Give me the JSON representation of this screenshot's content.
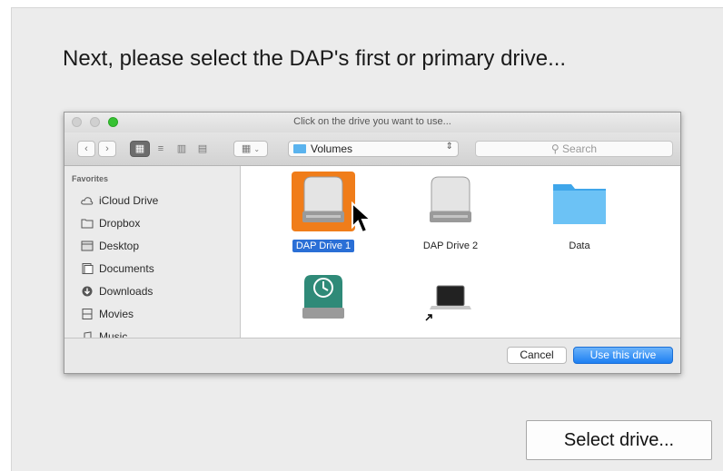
{
  "instruction": "Next, please select the DAP's first or primary drive...",
  "dialog": {
    "title": "Click on the drive you want to use...",
    "location": "Volumes",
    "search_placeholder": "Search",
    "sidebar": {
      "heading": "Favorites",
      "items": [
        {
          "label": "iCloud Drive",
          "icon": "cloud-icon"
        },
        {
          "label": "Dropbox",
          "icon": "folder-icon"
        },
        {
          "label": "Desktop",
          "icon": "desktop-icon"
        },
        {
          "label": "Documents",
          "icon": "documents-icon"
        },
        {
          "label": "Downloads",
          "icon": "downloads-icon"
        },
        {
          "label": "Movies",
          "icon": "movies-icon"
        },
        {
          "label": "Music",
          "icon": "music-icon"
        }
      ]
    },
    "files": [
      {
        "label": "DAP Drive 1",
        "icon": "hard-drive-icon",
        "selected": true
      },
      {
        "label": "DAP Drive 2",
        "icon": "hard-drive-icon",
        "selected": false
      },
      {
        "label": "Data",
        "icon": "folder-icon",
        "selected": false
      },
      {
        "label": "",
        "icon": "time-machine-drive-icon",
        "selected": false
      },
      {
        "label": "",
        "icon": "laptop-alias-icon",
        "selected": false
      }
    ],
    "cancel_label": "Cancel",
    "confirm_label": "Use this drive"
  },
  "select_button_label": "Select drive...",
  "colors": {
    "selection_orange": "#f07d1a",
    "selection_blue": "#2a6fd6",
    "folder_blue": "#5ab3ee",
    "accent_green": "#37c233"
  }
}
